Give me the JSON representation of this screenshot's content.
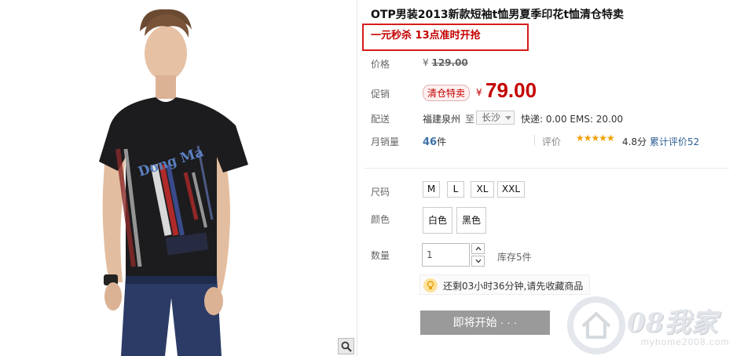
{
  "product": {
    "title": "OTP男装2013新款短袖t恤男夏季印花t恤清仓特卖",
    "promo": "一元秒杀 13点准时开抢",
    "shirt_print": "Dong Ma"
  },
  "price": {
    "label": "价格",
    "currency": "¥",
    "original": "129.00",
    "promo_label": "促销",
    "badge": "清仓特卖",
    "sale": "79.00"
  },
  "shipping": {
    "label": "配送",
    "from": "福建泉州",
    "to_word": "至",
    "city": "长沙",
    "fees": "快递: 0.00 EMS: 20.00"
  },
  "sales": {
    "label": "月销量",
    "count": "46",
    "unit": "件",
    "rating_label": "评价",
    "stars": "★★★★★",
    "score": "4.8分",
    "reviews": "累计评价52"
  },
  "sku": {
    "size_label": "尺码",
    "sizes": [
      "M",
      "L",
      "XL",
      "XXL"
    ],
    "color_label": "颜色",
    "colors": [
      "白色",
      "黑色"
    ],
    "qty_label": "数量",
    "qty_value": "1",
    "stock": "库存5件"
  },
  "tip": "还剩03小时36分钟,请先收藏商品",
  "buy_button": "即将开始 · · ·",
  "watermark": {
    "text": "08我家",
    "url": "myhome2008.com"
  },
  "colors": {
    "accent_red": "#c40000",
    "promo_border": "#d61b1b",
    "link_blue": "#2c5d93",
    "star": "#f0a000",
    "button_gray": "#9a9a9a"
  }
}
